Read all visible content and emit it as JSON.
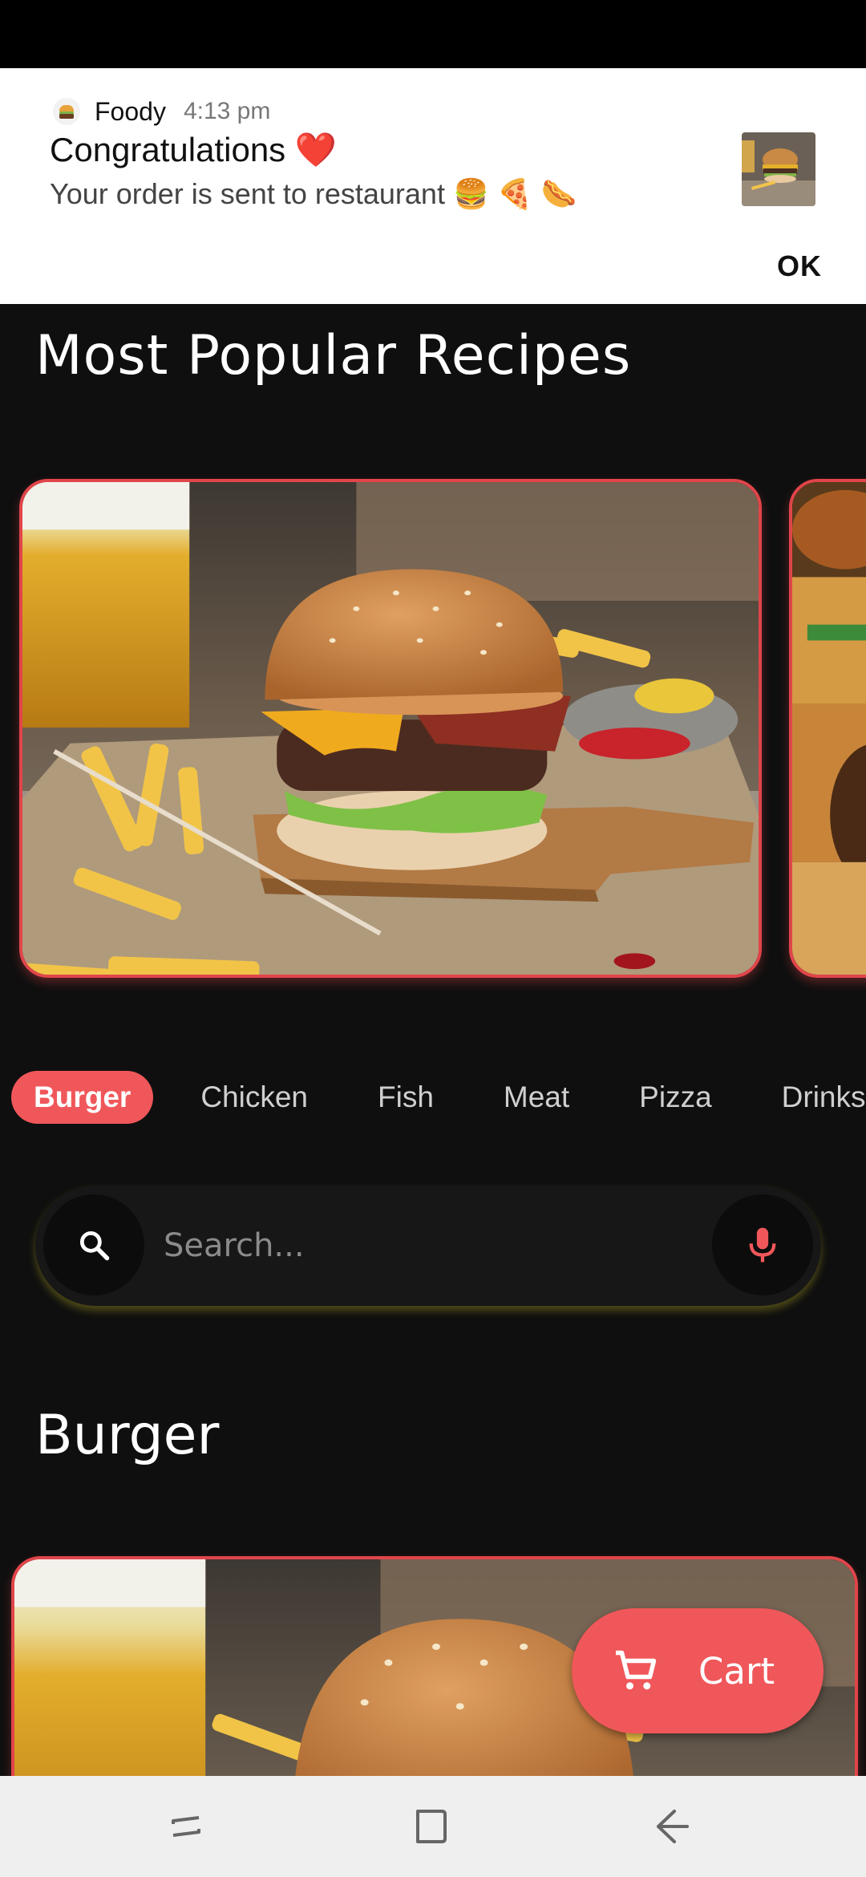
{
  "notification": {
    "app_name": "Foody",
    "time": "4:13 pm",
    "title": "Congratulations ❤️",
    "body": "Your order is sent to restaurant 🍔 🍕 🌭",
    "action": "OK"
  },
  "sections": {
    "popular_title": "Most Popular Recipes",
    "category_title": "Burger"
  },
  "categories": [
    {
      "label": "Burger",
      "active": true
    },
    {
      "label": "Chicken",
      "active": false
    },
    {
      "label": "Fish",
      "active": false
    },
    {
      "label": "Meat",
      "active": false
    },
    {
      "label": "Pizza",
      "active": false
    },
    {
      "label": "Drinks",
      "active": false
    }
  ],
  "search": {
    "placeholder": "Search...",
    "search_icon": "search-icon",
    "mic_icon": "microphone-icon"
  },
  "cart": {
    "label": "Cart",
    "icon": "cart-icon"
  },
  "colors": {
    "accent": "#f0575a",
    "background": "#0f0f0f",
    "search_glow": "#c8be28"
  },
  "navigation": {
    "recents_icon": "recents-icon",
    "home_icon": "home-icon",
    "back_icon": "back-icon"
  }
}
